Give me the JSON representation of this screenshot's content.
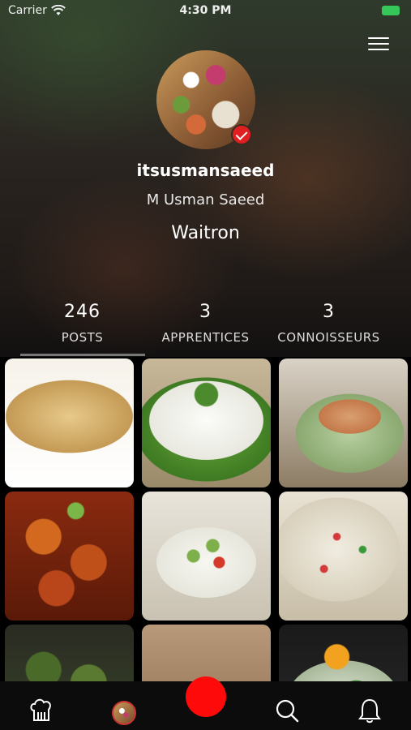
{
  "status_bar": {
    "carrier": "Carrier",
    "time": "4:30 PM"
  },
  "profile": {
    "username": "itsusmansaeed",
    "full_name": "M Usman Saeed",
    "role": "Waitron",
    "verified": true
  },
  "stats": [
    {
      "value": "246",
      "label": "POSTS",
      "selected": true
    },
    {
      "value": "3",
      "label": "APPRENTICES"
    },
    {
      "value": "3",
      "label": "CONNOISSEURS"
    }
  ],
  "grid": [
    {
      "name": "food-tile-rice-pudding",
      "bg": "radial-gradient(ellipse 70% 40% at 50% 45%, #e7c98a, #c49a55 70%, transparent 71%), linear-gradient(#f6f2ea, #ffffff)"
    },
    {
      "name": "food-tile-white-rice",
      "bg": "radial-gradient(circle at 50% 28%, #4c8a2e 0 10%, transparent 11%), radial-gradient(ellipse 55% 38% at 50% 48%, #fbfbf8, #e8e8e0 80%, transparent 81%), radial-gradient(ellipse 68% 50% at 50% 55%, #6aa83a, #3d7a22 80%, transparent 81%), linear-gradient(#c8b89a, #9a8a6a)"
    },
    {
      "name": "food-tile-chicken-salad",
      "bg": "radial-gradient(ellipse 40% 22% at 55% 45%, #d9a070, #c4784a 60%, transparent 61%), radial-gradient(ellipse 52% 38% at 55% 58%, #b8cfa0, #8aa870 80%, transparent 81%), linear-gradient(#d9d2c6, #8c7c64)"
    },
    {
      "name": "food-tile-orange-chicken",
      "bg": "radial-gradient(circle at 30% 35%, #d2691e 0 14%, transparent 15%), radial-gradient(circle at 65% 55%, #c0501a 0 16%, transparent 17%), radial-gradient(circle at 40% 75%, #b8461a 0 14%, transparent 15%), radial-gradient(circle at 55% 15%, #7ab648 0 6%, transparent 7%), linear-gradient(#8a2a10, #5a1a08)"
    },
    {
      "name": "food-tile-edamame-salad",
      "bg": "radial-gradient(circle at 40% 50%, #7db04a 0 6%, transparent 7%), radial-gradient(circle at 60% 55%, #d43a2a 0 5%, transparent 6%), radial-gradient(circle at 55% 42%, #7db04a 0 6%, transparent 7%), radial-gradient(ellipse 48% 34% at 50% 55%, #f7f7f2, #e6e6dc 80%, transparent 81%), linear-gradient(#e8e4da, #c9c2b2)"
    },
    {
      "name": "food-tile-sprinkle-cookies",
      "bg": "radial-gradient(circle at 45% 35%, #d43a3a 0 3%, transparent 4%), radial-gradient(circle at 65% 45%, #3a9a3a 0 3%, transparent 4%), radial-gradient(circle at 35% 60%, #d43a3a 0 3%, transparent 4%), radial-gradient(ellipse 60% 50% at 45% 45%, #f0ece0, #d8d0bc 80%, transparent 81%), linear-gradient(#e8e2d4, #c8bea8)"
    },
    {
      "name": "food-tile-brussels-sprouts",
      "bg": "radial-gradient(circle at 30% 35%, #4a6a2a 0 14%, transparent 15%), radial-gradient(circle at 65% 45%, #5a7a32 0 16%, transparent 17%), linear-gradient(#2a2a22, #3a4a2a)"
    },
    {
      "name": "food-tile-crackers-plate",
      "bg": "radial-gradient(ellipse 40% 18% at 50% 70%, #e08a4a, #c86a30 70%, transparent 71%), radial-gradient(ellipse 60% 30% at 50% 80%, #f4f4f0, #dcdcd4 80%, transparent 81%), linear-gradient(#b89a7a, #8a6a4a)"
    },
    {
      "name": "food-tile-veggie-bowl",
      "bg": "radial-gradient(circle at 45% 25%, #f2a21e 0 10%, transparent 11%), radial-gradient(circle at 60% 55%, #3a8a3a 0 14%, transparent 15%), radial-gradient(ellipse 55% 40% at 50% 60%, #dfe6d4, #a8b89a 80%, transparent 81%), linear-gradient(#1a1a1a, #2a2a2a)"
    }
  ],
  "tabs": [
    {
      "name": "chef-hat-icon"
    },
    {
      "name": "profile-avatar-tab"
    },
    {
      "name": "record-button"
    },
    {
      "name": "search-icon"
    },
    {
      "name": "bell-icon"
    }
  ],
  "colors": {
    "accent": "#ff0a0a",
    "verified": "#e02020",
    "battery": "#35c759"
  }
}
